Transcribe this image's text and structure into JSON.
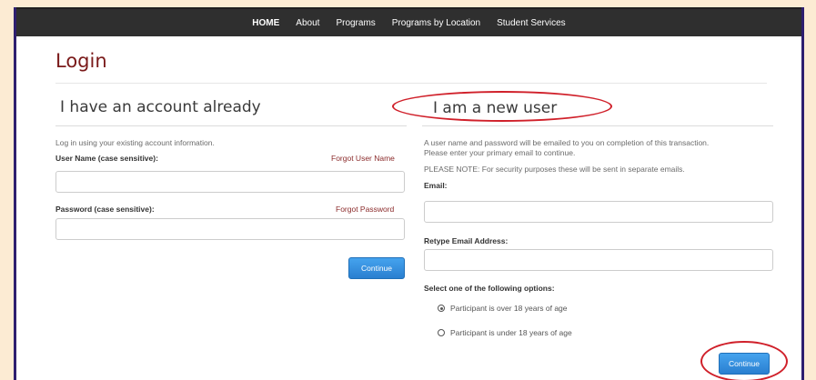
{
  "nav": {
    "items": [
      "HOME",
      "About",
      "Programs",
      "Programs by Location",
      "Student Services"
    ]
  },
  "page": {
    "title": "Login"
  },
  "existing": {
    "heading": "I have an account already",
    "intro": "Log in using your existing account information.",
    "username_label": "User Name (case sensitive):",
    "forgot_username": "Forgot User Name",
    "password_label": "Password (case sensitive):",
    "forgot_password": "Forgot Password",
    "username_value": "",
    "password_value": "",
    "continue_label": "Continue"
  },
  "newuser": {
    "heading": "I am a new user",
    "intro_line1": "A user name and password will be emailed to you on completion of this transaction.",
    "intro_line2": "Please enter your primary email to continue.",
    "note": "PLEASE NOTE: For security purposes these will be sent in separate emails.",
    "email_label": "Email:",
    "retype_label": "Retype Email Address:",
    "email_value": "",
    "retype_value": "",
    "options_label": "Select one of the following options:",
    "options": [
      {
        "label": "Participant is over 18 years of age",
        "selected": true
      },
      {
        "label": "Participant is under 18 years of age",
        "selected": false
      }
    ],
    "continue_label": "Continue"
  },
  "colors": {
    "accent_oval": "#d0202a",
    "button": "#2a7fd0",
    "title": "#7a1a1a",
    "nav_bg": "#2f2f2f"
  }
}
